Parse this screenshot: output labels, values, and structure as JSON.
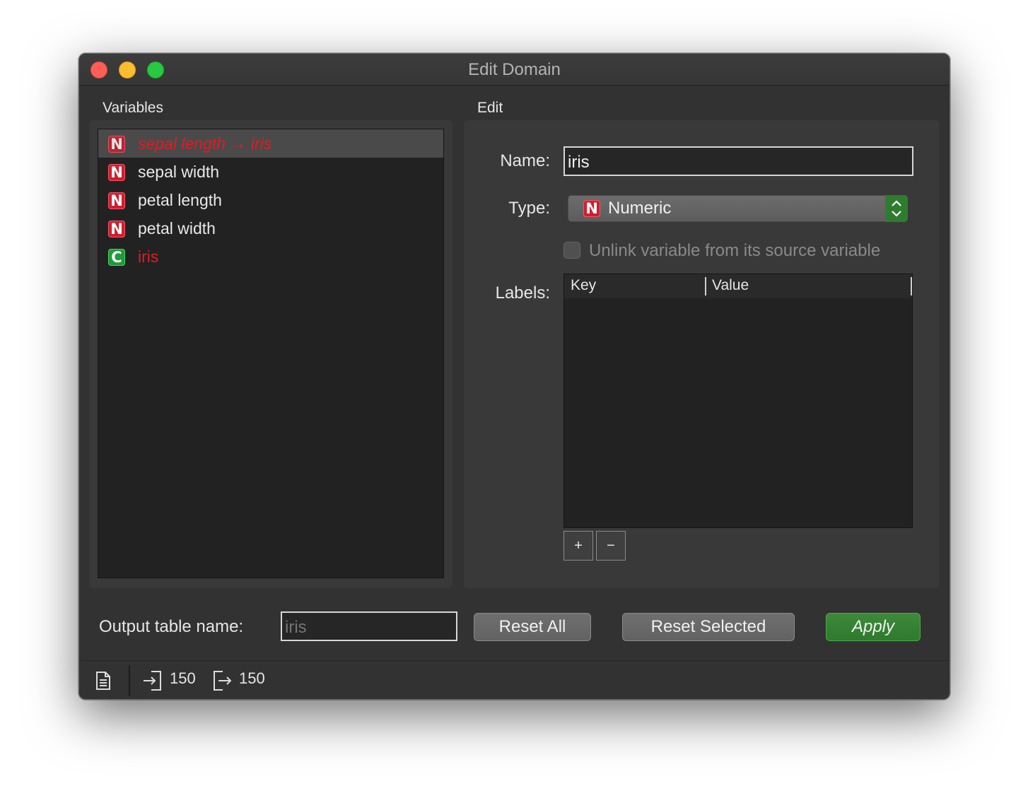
{
  "window": {
    "title": "Edit Domain"
  },
  "variables": {
    "heading": "Variables",
    "items": [
      {
        "badge": "N",
        "label": "sepal length → iris",
        "selected": true
      },
      {
        "badge": "N",
        "label": "sepal width"
      },
      {
        "badge": "N",
        "label": "petal length"
      },
      {
        "badge": "N",
        "label": "petal width"
      },
      {
        "badge": "C",
        "label": "iris"
      }
    ]
  },
  "edit": {
    "heading": "Edit",
    "name_label": "Name:",
    "name_value": "iris",
    "type_label": "Type:",
    "type_badge": "N",
    "type_value": "Numeric",
    "unlink_label": "Unlink variable from its source variable",
    "labels_label": "Labels:",
    "columns": [
      "Key",
      "Value"
    ],
    "add_label": "+",
    "remove_label": "−"
  },
  "footer": {
    "output_label": "Output table name:",
    "output_placeholder": "iris",
    "reset_all": "Reset All",
    "reset_selected": "Reset Selected",
    "apply": "Apply"
  },
  "status": {
    "input_count": "150",
    "output_count": "150"
  },
  "colors": {
    "numeric_badge": "#d21d2f",
    "categorical_badge": "#1e9b3a",
    "modified_text": "#e21b23",
    "apply_button": "#2f7a2e",
    "window_bg": "#323232"
  },
  "icons": {
    "report": "report-icon",
    "input": "input-arrow-icon",
    "output": "output-arrow-icon"
  }
}
